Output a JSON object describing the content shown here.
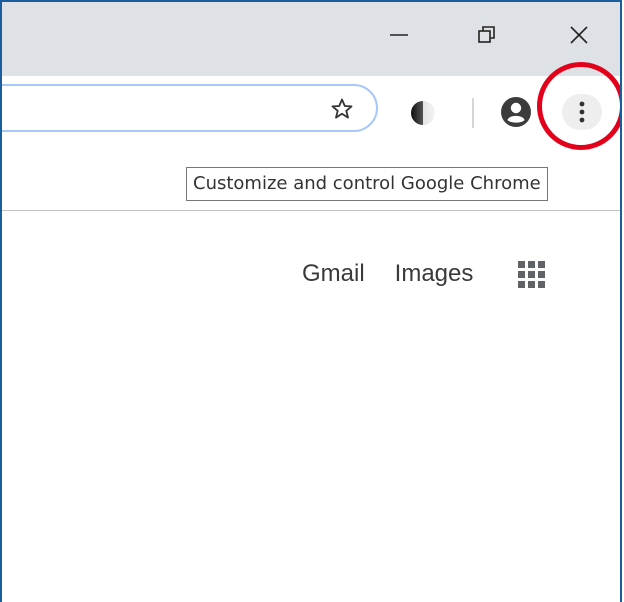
{
  "titlebar": {
    "icons": [
      "minimize-icon",
      "restore-icon",
      "close-icon"
    ]
  },
  "toolbar": {
    "icons": [
      "star-icon",
      "extension-icon",
      "profile-icon",
      "menu-dots-icon"
    ]
  },
  "tooltip": {
    "text": "Customize and control Google Chrome"
  },
  "google_bar": {
    "gmail": "Gmail",
    "images": "Images",
    "apps_icon": "apps-grid-icon"
  },
  "colors": {
    "highlight": "#e3001b",
    "titlebar": "#dee1e6",
    "window_border": "#1b5e9e",
    "omnibox_focus": "#a8c7fa"
  }
}
